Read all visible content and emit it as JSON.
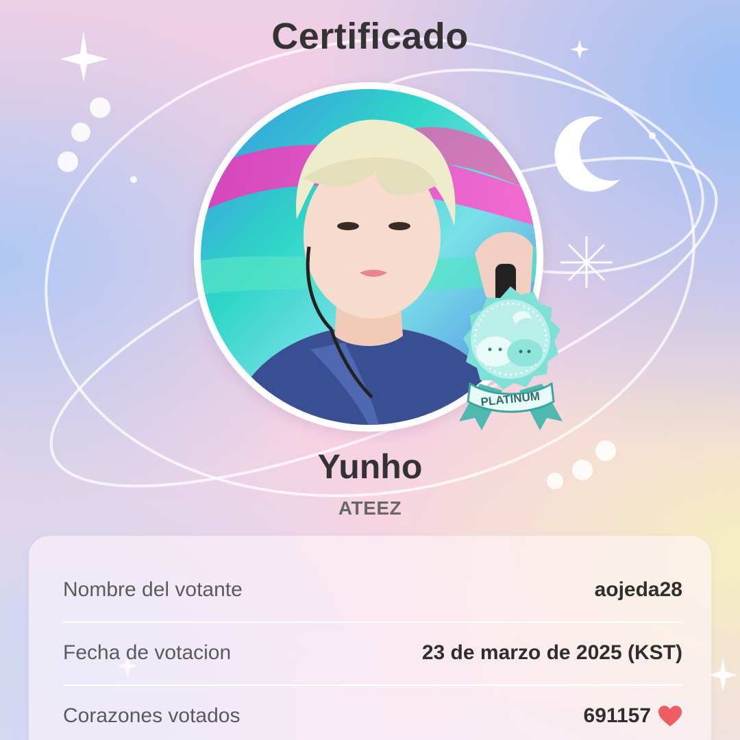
{
  "certificate": {
    "title": "Certificado",
    "artist": {
      "name": "Yunho",
      "group": "ATEEZ",
      "photo_icon": "artist-photo"
    },
    "badge": {
      "level": "PLATINUM",
      "icon": "platinum-medal-icon",
      "color": "#5fd0c8"
    },
    "details": [
      {
        "label": "Nombre del votante",
        "value": "aojeda28"
      },
      {
        "label": "Fecha de votacion",
        "value": "23 de marzo de 2025 (KST)"
      },
      {
        "label": "Corazones votados",
        "value": "691157",
        "icon": "heart-icon",
        "icon_color": "#ef5c62"
      }
    ]
  }
}
